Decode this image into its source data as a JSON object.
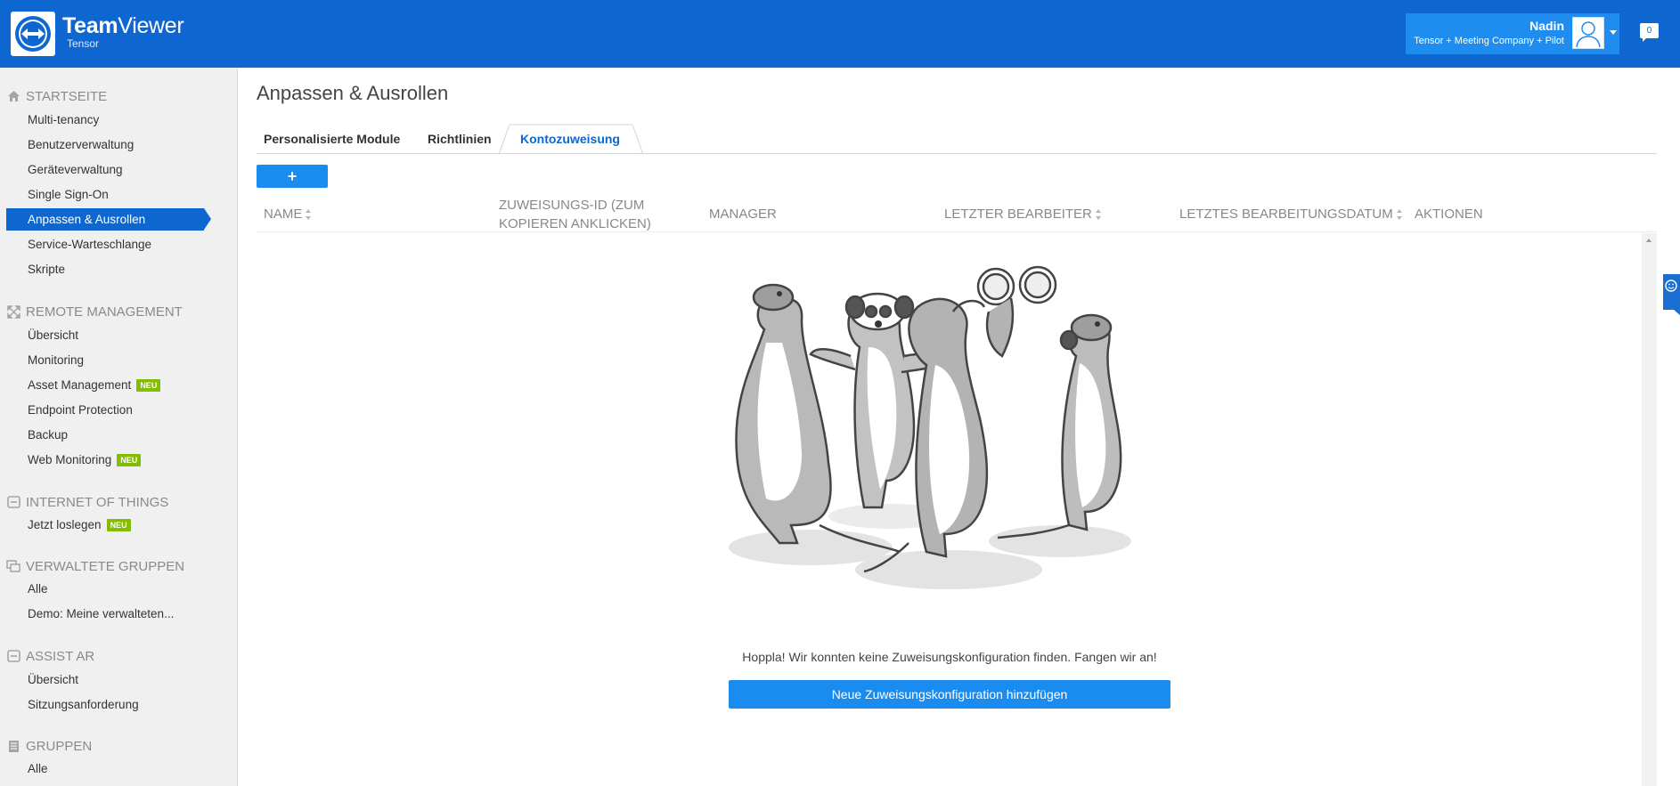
{
  "header": {
    "brand_bold": "Team",
    "brand_light": "Viewer",
    "brand_sub": "Tensor",
    "user_name": "Nadin",
    "user_company": "Tensor + Meeting Company + Pilot",
    "notification_count": "0"
  },
  "sidebar": {
    "sections": [
      {
        "title": "STARTSEITE",
        "icon": "home-icon",
        "items": [
          "Multi-tenancy",
          "Benutzerverwaltung",
          "Geräteverwaltung",
          "Single Sign-On",
          "Anpassen & Ausrollen",
          "Service-Warteschlange",
          "Skripte"
        ]
      },
      {
        "title": "REMOTE MANAGEMENT",
        "icon": "remote-management-icon",
        "items": [
          "Übersicht",
          "Monitoring",
          "Asset Management",
          "Endpoint Protection",
          "Backup",
          "Web Monitoring"
        ]
      },
      {
        "title": "INTERNET OF THINGS",
        "icon": "iot-icon",
        "items": [
          "Jetzt loslegen"
        ]
      },
      {
        "title": "VERWALTETE GRUPPEN",
        "icon": "managed-groups-icon",
        "items": [
          "Alle",
          "Demo: Meine verwalteten..."
        ]
      },
      {
        "title": "ASSIST AR",
        "icon": "assist-ar-icon",
        "items": [
          "Übersicht",
          "Sitzungsanforderung"
        ]
      },
      {
        "title": "GRUPPEN",
        "icon": "groups-icon",
        "items": [
          "Alle"
        ]
      }
    ],
    "active_item": "Anpassen & Ausrollen",
    "badge_label": "NEU"
  },
  "main": {
    "title": "Anpassen & Ausrollen",
    "tabs": [
      "Personalisierte Module",
      "Richtlinien",
      "Kontozuweisung"
    ],
    "active_tab": "Kontozuweisung",
    "add_label": "+",
    "columns": [
      "NAME",
      "ZUWEISUNGS-ID (ZUM",
      "KOPIEREN ANKLICKEN)",
      "MANAGER",
      "LETZTER BEARBEITER",
      "LETZTES BEARBEITUNGSDATUM",
      "AKTIONEN"
    ],
    "empty_message": "Hoppla! Wir konnten keine Zuweisungskonfiguration finden. Fangen wir an!",
    "cta_label": "Neue Zuweisungskonfiguration hinzufügen"
  },
  "colors": {
    "brand_blue": "#0e67d0",
    "button_blue": "#1a8cf0",
    "badge_green": "#84bd00"
  }
}
